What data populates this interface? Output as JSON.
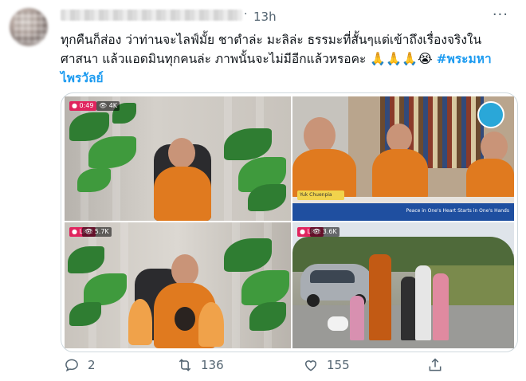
{
  "tweet": {
    "time": "13h",
    "text": "ทุกคืนก็ส่อง ว่าท่านจะไลฟ์มั้ย ชาตำล่ะ มะลิล่ะ ธรรมะที่สั้นๆแต่เข้าถึงเรื่องจริงในศาสนา แล้วแอดมินทุกคนล่ะ ภาพนั้นจะไม่มีอีกแล้วหรอคะ ",
    "emojis": "🙏🙏🙏😭",
    "hashtag": "#พระมหาไพรวัลย์",
    "more_icon": "more-horizontal-icon"
  },
  "media": {
    "c1": {
      "live": "● 0:49",
      "views": "👁 4K"
    },
    "c2": {
      "tag": "Yuk Chuenpia",
      "banner": "Peace in One's Heart Starts in One's Hands"
    },
    "c3": {
      "live": "● LIVE",
      "views": "👁 5.7K"
    },
    "c4": {
      "live": "● LIVE",
      "views": "👁 3.6K"
    }
  },
  "actions": {
    "reply": "2",
    "retweet": "136",
    "like": "155"
  },
  "colors": {
    "link": "#1d9bf0",
    "muted": "#536471",
    "text": "#0f1419",
    "live": "#e0245e"
  }
}
